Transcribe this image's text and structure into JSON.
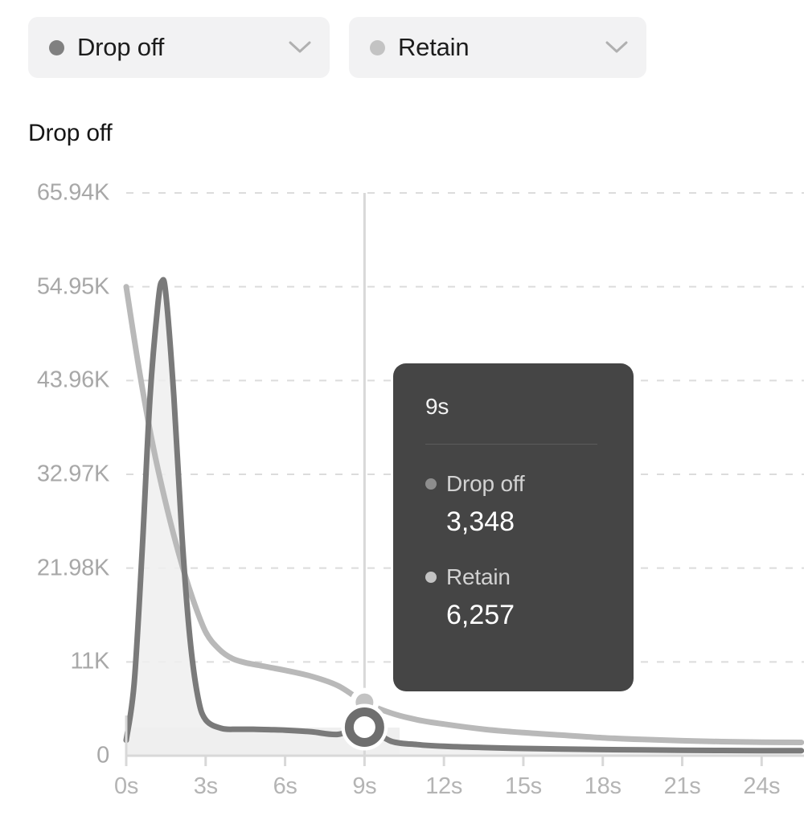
{
  "selectors": [
    {
      "label": "Drop off",
      "dot_color": "#808080",
      "icon": "chevron-down-icon"
    },
    {
      "label": "Retain",
      "dot_color": "#c3c3c3",
      "icon": "chevron-down-icon"
    }
  ],
  "chart_title": "Drop off",
  "tooltip": {
    "time": "9s",
    "rows": [
      {
        "name": "Drop off",
        "value": "3,348",
        "dot_color": "#8e8e8e"
      },
      {
        "name": "Retain",
        "value": "6,257",
        "dot_color": "#c3c3c3"
      }
    ]
  },
  "colors": {
    "drop_off_line": "#7a7a7a",
    "retain_line": "#b9b9b9",
    "area_fill": "#efefef",
    "gridline": "#dcdcdc",
    "crosshair": "#d8d8d8",
    "tooltip_bg": "#454545",
    "axis": "#d8d8d8"
  },
  "chart_data": {
    "type": "area",
    "title": "Drop off",
    "xlabel": "",
    "ylabel": "",
    "grid": true,
    "legend": "top",
    "xlim": [
      0,
      25.6
    ],
    "ylim": [
      0,
      65940
    ],
    "x_tick_labels": [
      "0s",
      "3s",
      "6s",
      "9s",
      "12s",
      "15s",
      "18s",
      "21s",
      "24s"
    ],
    "x_tick_values": [
      0,
      3,
      6,
      9,
      12,
      15,
      18,
      21,
      24
    ],
    "y_tick_labels": [
      "0",
      "11K",
      "21.98K",
      "32.97K",
      "43.96K",
      "54.95K",
      "65.94K"
    ],
    "y_tick_values": [
      0,
      10990,
      21980,
      32970,
      43960,
      54950,
      65940
    ],
    "highlight_x": "9s",
    "series": [
      {
        "name": "Drop off",
        "color": "#7a7a7a",
        "filled": true,
        "x": [
          0,
          0.3,
          0.6,
          0.9,
          1.2,
          1.35,
          1.5,
          1.8,
          2.1,
          2.4,
          2.7,
          3.0,
          3.6,
          4.2,
          4.8,
          5.4,
          6.0,
          7.0,
          8.0,
          9.0,
          10.0,
          11.0,
          12.0,
          13.5,
          15.0,
          16.5,
          18.0,
          19.5,
          21.0,
          22.5,
          24.0,
          25.5
        ],
        "values": [
          1800,
          8500,
          24000,
          42000,
          53000,
          55600,
          54000,
          42000,
          26000,
          14000,
          7000,
          4200,
          3200,
          3100,
          3100,
          3050,
          3000,
          2800,
          2500,
          3348,
          1700,
          1300,
          1100,
          950,
          850,
          780,
          720,
          680,
          640,
          610,
          590,
          580
        ]
      },
      {
        "name": "Retain",
        "color": "#b9b9b9",
        "filled": false,
        "x": [
          0,
          0.5,
          1.0,
          1.5,
          2.0,
          2.5,
          3.0,
          3.5,
          4.0,
          4.5,
          5.0,
          5.5,
          6.0,
          7.0,
          8.0,
          9.0,
          10.0,
          11.0,
          12.0,
          13.5,
          15.0,
          16.5,
          18.0,
          19.5,
          21.0,
          22.5,
          24.0,
          25.5
        ],
        "values": [
          54950,
          45000,
          36500,
          29500,
          23500,
          18500,
          14500,
          12500,
          11400,
          10900,
          10600,
          10300,
          10000,
          9300,
          8200,
          6257,
          5000,
          4200,
          3700,
          3100,
          2700,
          2400,
          2100,
          1900,
          1750,
          1650,
          1580,
          1550
        ]
      }
    ],
    "highlight_points": [
      {
        "series": "Retain",
        "x": 9,
        "y": 6257,
        "marker": "small-dot"
      },
      {
        "series": "Drop off",
        "x": 9,
        "y": 3348,
        "marker": "ring"
      }
    ]
  }
}
